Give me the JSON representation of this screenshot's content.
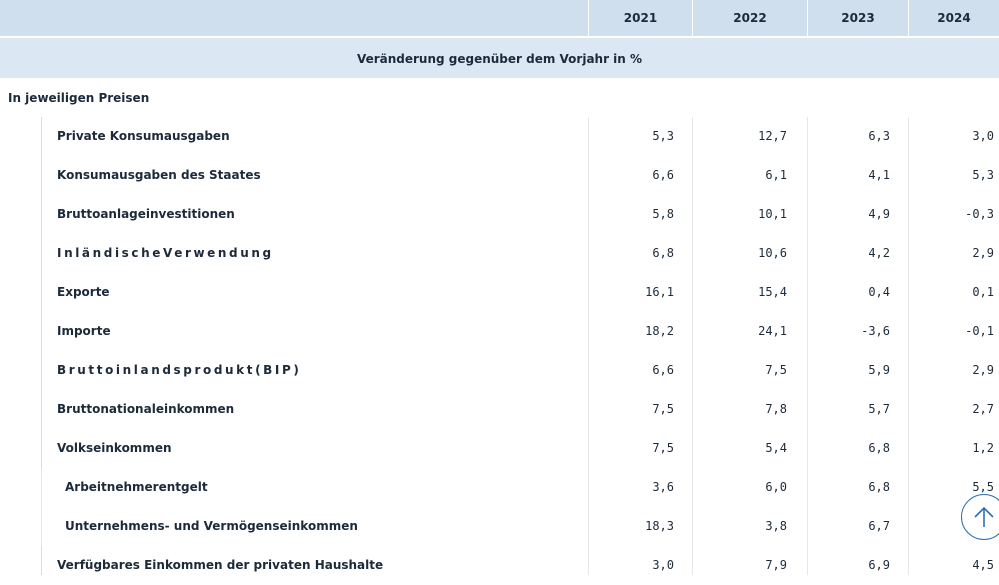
{
  "header": {
    "years": [
      "2021",
      "2022",
      "2023",
      "2024"
    ]
  },
  "subheader": "Veränderung gegenüber dem Vorjahr in %",
  "section_title": "In jeweiligen Preisen",
  "rows": [
    {
      "label": "Private Konsumausgaben",
      "values": [
        "5,3",
        "12,7",
        "6,3",
        "3,0"
      ]
    },
    {
      "label": "Konsumausgaben des Staates",
      "values": [
        "6,6",
        "6,1",
        "4,1",
        "5,3"
      ]
    },
    {
      "label": "Bruttoanlageinvestitionen",
      "values": [
        "5,8",
        "10,1",
        "4,9",
        "-0,3"
      ]
    },
    {
      "label": "InländischeVerwendung",
      "values": [
        "6,8",
        "10,6",
        "4,2",
        "2,9"
      ]
    },
    {
      "label": "Exporte",
      "values": [
        "16,1",
        "15,4",
        "0,4",
        "0,1"
      ]
    },
    {
      "label": "Importe",
      "values": [
        "18,2",
        "24,1",
        "-3,6",
        "-0,1"
      ]
    },
    {
      "label": "Bruttoinlandsprodukt(BIP)",
      "values": [
        "6,6",
        "7,5",
        "5,9",
        "2,9"
      ]
    },
    {
      "label": "Bruttonationaleinkommen",
      "values": [
        "7,5",
        "7,8",
        "5,7",
        "2,7"
      ]
    },
    {
      "label": "Volkseinkommen",
      "values": [
        "7,5",
        "5,4",
        "6,8",
        "1,2"
      ]
    },
    {
      "label": "Arbeitnehmerentgelt",
      "values": [
        "3,6",
        "6,0",
        "6,8",
        "5,5"
      ]
    },
    {
      "label": "Unternehmens- und Vermögenseinkommen",
      "values": [
        "18,3",
        "3,8",
        "6,7",
        ""
      ]
    },
    {
      "label": "Verfügbares Einkommen der privaten Haushalte",
      "values": [
        "3,0",
        "7,9",
        "6,9",
        "4,5"
      ]
    }
  ],
  "icons": {
    "scroll_top": "arrow-up-icon"
  },
  "colors": {
    "header_bg": "#cfdfee",
    "subheader_bg": "#dbe8f4",
    "accent": "#2d6fb0"
  }
}
